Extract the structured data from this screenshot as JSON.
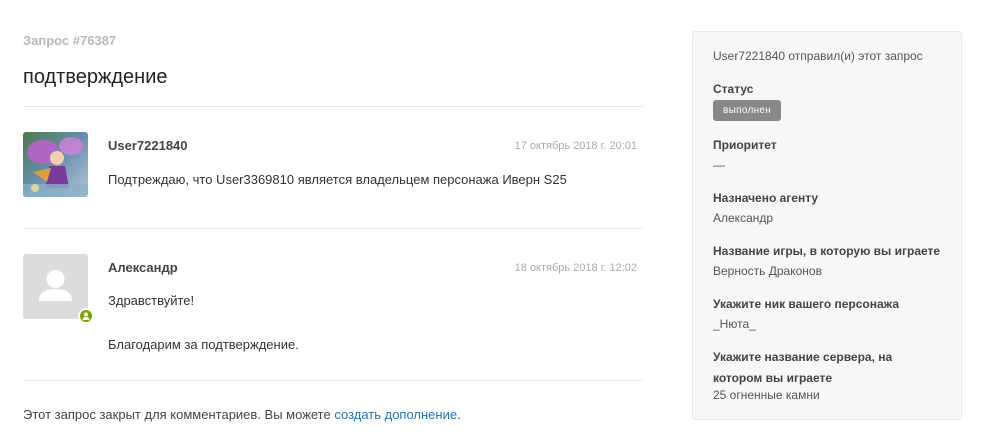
{
  "request": {
    "id_label": "Запрос #76387",
    "title": "подтверждение"
  },
  "comments": [
    {
      "author": "User7221840",
      "date": "17 октябрь 2018 г. 20:01",
      "paragraphs": [
        "Подтреждаю, что User3369810 является владельцем персонажа Иверн S25"
      ],
      "is_agent": false
    },
    {
      "author": "Александр",
      "date": "18 октябрь 2018 г. 12:02",
      "paragraphs": [
        "Здравствуйте!",
        "Благодарим за подтверждение."
      ],
      "is_agent": true
    }
  ],
  "footer": {
    "closed_text": "Этот запрос закрыт для комментариев. Вы можете ",
    "followup_link": "создать дополнение",
    "closed_end": "."
  },
  "sidebar": {
    "submitted_by": "User7221840 отправил(и) этот запрос",
    "status_label": "Статус",
    "status_value": "выполнен",
    "priority_label": "Приоритет",
    "priority_value": "—",
    "assignee_label": "Назначено агенту",
    "assignee_value": "Александр",
    "game_label": "Название игры, в которую вы играете",
    "game_value": "Верность Драконов",
    "nick_label": "Укажите ник вашего персонажа",
    "nick_value": "_Нюта_",
    "server_label": "Укажите название сервера, на котором вы играете",
    "server_value": "25 огненные камни"
  },
  "colors": {
    "link": "#1f73b7",
    "status_badge": "#888888",
    "agent_badge": "#78a300"
  }
}
